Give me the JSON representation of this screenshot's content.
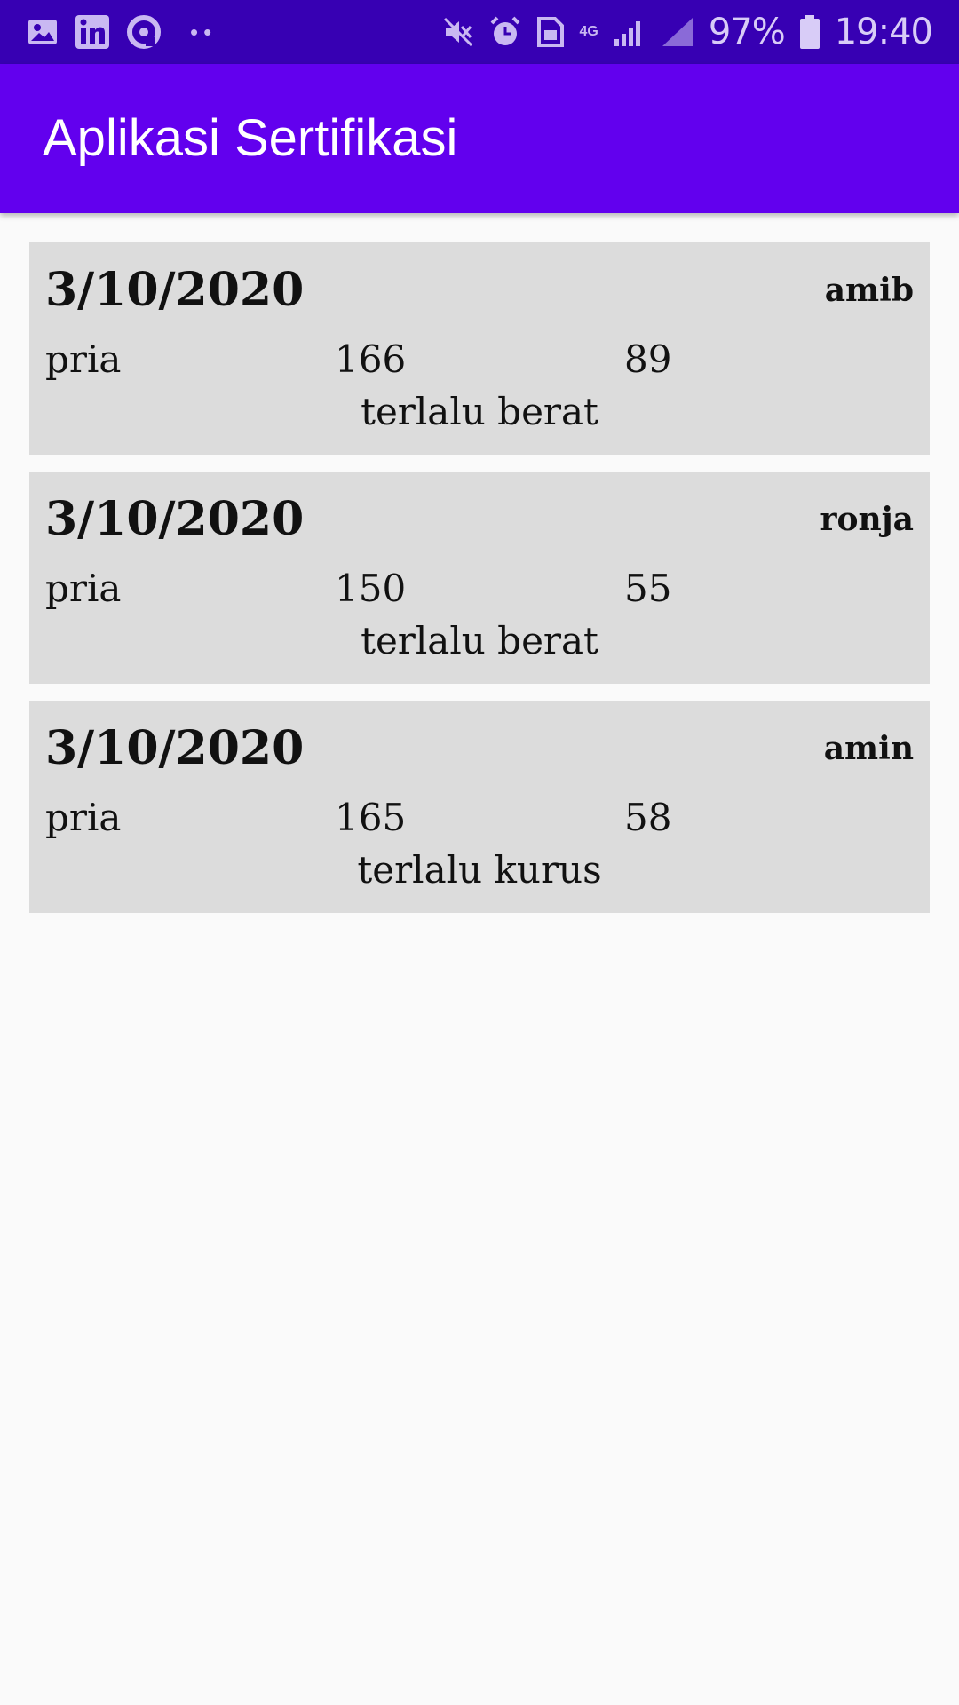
{
  "status_bar": {
    "battery_percent": "97%",
    "time": "19:40",
    "network_type": "4G",
    "left_icons": [
      "gallery-icon",
      "linkedin-icon",
      "target-icon"
    ],
    "right_icons": [
      "mute-icon",
      "alarm-icon",
      "sim-icon",
      "signal-icon",
      "signal-2-icon",
      "battery-icon"
    ]
  },
  "app_bar": {
    "title": "Aplikasi Sertifikasi",
    "color": "#6200ee"
  },
  "records": [
    {
      "date": "3/10/2020",
      "name": "amib",
      "gender": "pria",
      "height": "166",
      "weight": "89",
      "status": "terlalu berat"
    },
    {
      "date": "3/10/2020",
      "name": "ronja",
      "gender": "pria",
      "height": "150",
      "weight": "55",
      "status": "terlalu berat"
    },
    {
      "date": "3/10/2020",
      "name": "amin",
      "gender": "pria",
      "height": "165",
      "weight": "58",
      "status": "terlalu kurus"
    }
  ]
}
